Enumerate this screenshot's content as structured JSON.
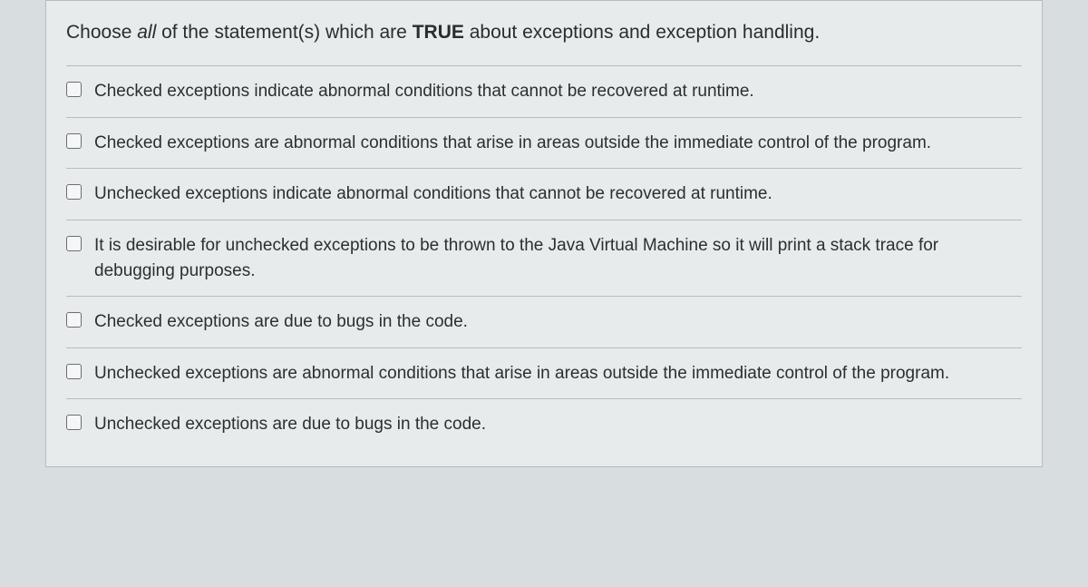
{
  "question": {
    "prompt_pre": "Choose ",
    "prompt_all": "all",
    "prompt_mid": " of the statement(s) which are ",
    "prompt_true": "TRUE",
    "prompt_post": " about exceptions and exception handling."
  },
  "options": [
    {
      "text": "Checked exceptions indicate abnormal conditions that cannot be recovered at runtime."
    },
    {
      "text": "Checked exceptions are abnormal conditions that arise in areas outside the immediate control of the program."
    },
    {
      "text": "Unchecked exceptions indicate abnormal conditions that cannot be recovered at runtime."
    },
    {
      "text": "It is desirable for unchecked exceptions to be thrown to the Java Virtual Machine so it will print a stack trace for debugging purposes."
    },
    {
      "text": "Checked exceptions are due to bugs in the code."
    },
    {
      "text": "Unchecked exceptions are abnormal conditions that arise in areas outside the immediate control of the program."
    },
    {
      "text": "Unchecked exceptions are due to bugs in the code."
    }
  ]
}
